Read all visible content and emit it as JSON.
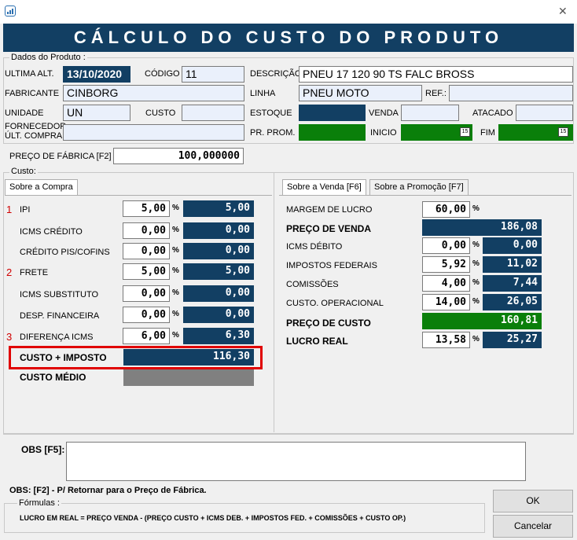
{
  "window": {
    "title": "CÁLCULO DO CUSTO DO PRODUTO",
    "close_glyph": "✕"
  },
  "produto": {
    "section_label": "Dados do Produto :",
    "ultima_alt_label": "ULTIMA ALT.",
    "ultima_alt_value": "13/10/2020",
    "codigo_label": "CÓDIGO",
    "codigo_value": "11",
    "descricao_label": "DESCRIÇÃO",
    "descricao_value": "PNEU 17 120 90 TS FALC BROSS",
    "fabricante_label": "FABRICANTE",
    "fabricante_value": "CINBORG",
    "linha_label": "LINHA",
    "linha_value": "PNEU MOTO",
    "ref_label": "REF.:",
    "ref_value": "",
    "unidade_label": "UNIDADE",
    "unidade_value": "UN",
    "custo_label": "CUSTO",
    "custo_value": "",
    "estoque_label": "ESTOQUE",
    "venda_label": "VENDA",
    "venda_value": "",
    "atacado_label": "ATACADO",
    "atacado_value": "",
    "fornecedor_label_1": "FORNECEDOR",
    "fornecedor_label_2": "ÚLT. COMPRA",
    "fornecedor_value": "",
    "pr_prom_label": "PR. PROM.",
    "inicio_label": "INICIO",
    "fim_label": "FIM",
    "calendar_glyph": "15"
  },
  "preco_fabrica": {
    "label": "PREÇO DE FÁBRICA [F2]",
    "value": "100,000000"
  },
  "custo": {
    "section_label": "Custo:",
    "tab": "Sobre a Compra",
    "rows": [
      {
        "marker": "1",
        "label": "IPI",
        "pct": "5,00",
        "value": "5,00"
      },
      {
        "marker": "",
        "label": "ICMS CRÉDITO",
        "pct": "0,00",
        "value": "0,00"
      },
      {
        "marker": "",
        "label": "CRÉDITO PIS/COFINS",
        "pct": "0,00",
        "value": "0,00"
      },
      {
        "marker": "2",
        "label": "FRETE",
        "pct": "5,00",
        "value": "5,00"
      },
      {
        "marker": "",
        "label": "ICMS SUBSTITUTO",
        "pct": "0,00",
        "value": "0,00"
      },
      {
        "marker": "",
        "label": "DESP. FINANCEIRA",
        "pct": "0,00",
        "value": "0,00"
      },
      {
        "marker": "3",
        "label": "DIFERENÇA ICMS",
        "pct": "6,00",
        "value": "6,30"
      }
    ],
    "pct_symbol": "%",
    "custo_imposto_label": "CUSTO + IMPOSTO",
    "custo_imposto_value": "116,30",
    "custo_medio_label": "CUSTO MÉDIO"
  },
  "venda": {
    "tab_venda": "Sobre a Venda [F6]",
    "tab_promocao": "Sobre a Promoção [F7]",
    "margem_label": "MARGEM DE LUCRO",
    "margem_pct": "60,00",
    "preco_venda_label": "PREÇO DE VENDA",
    "preco_venda_value": "186,08",
    "icms_debito_label": "ICMS DÉBITO",
    "icms_debito_pct": "0,00",
    "icms_debito_value": "0,00",
    "impostos_label": "IMPOSTOS FEDERAIS",
    "impostos_pct": "5,92",
    "impostos_value": "11,02",
    "comissoes_label": "COMISSÕES",
    "comissoes_pct": "4,00",
    "comissoes_value": "7,44",
    "custo_op_label": "CUSTO. OPERACIONAL",
    "custo_op_pct": "14,00",
    "custo_op_value": "26,05",
    "preco_custo_label": "PREÇO DE CUSTO",
    "preco_custo_value": "160,81",
    "lucro_label": "LUCRO REAL",
    "lucro_pct": "13,58",
    "lucro_value": "25,27"
  },
  "obs": {
    "label": "OBS [F5]:",
    "value": ""
  },
  "footer": {
    "obs_note": "OBS:  [F2] - P/ Retornar para o Preço de Fábrica.",
    "formulas_label": "Fórmulas :",
    "formula": "LUCRO EM REAL = PREÇO VENDA - (PREÇO CUSTO + ICMS DEB. + IMPOSTOS FED. + COMISSÕES + CUSTO OP.)",
    "ok_button": "OK",
    "cancel_button": "Cancelar"
  },
  "colors": {
    "dark_blue": "#123f63",
    "green": "#0a7f0a",
    "highlight_red": "#e00000",
    "gray_field": "#808080"
  }
}
